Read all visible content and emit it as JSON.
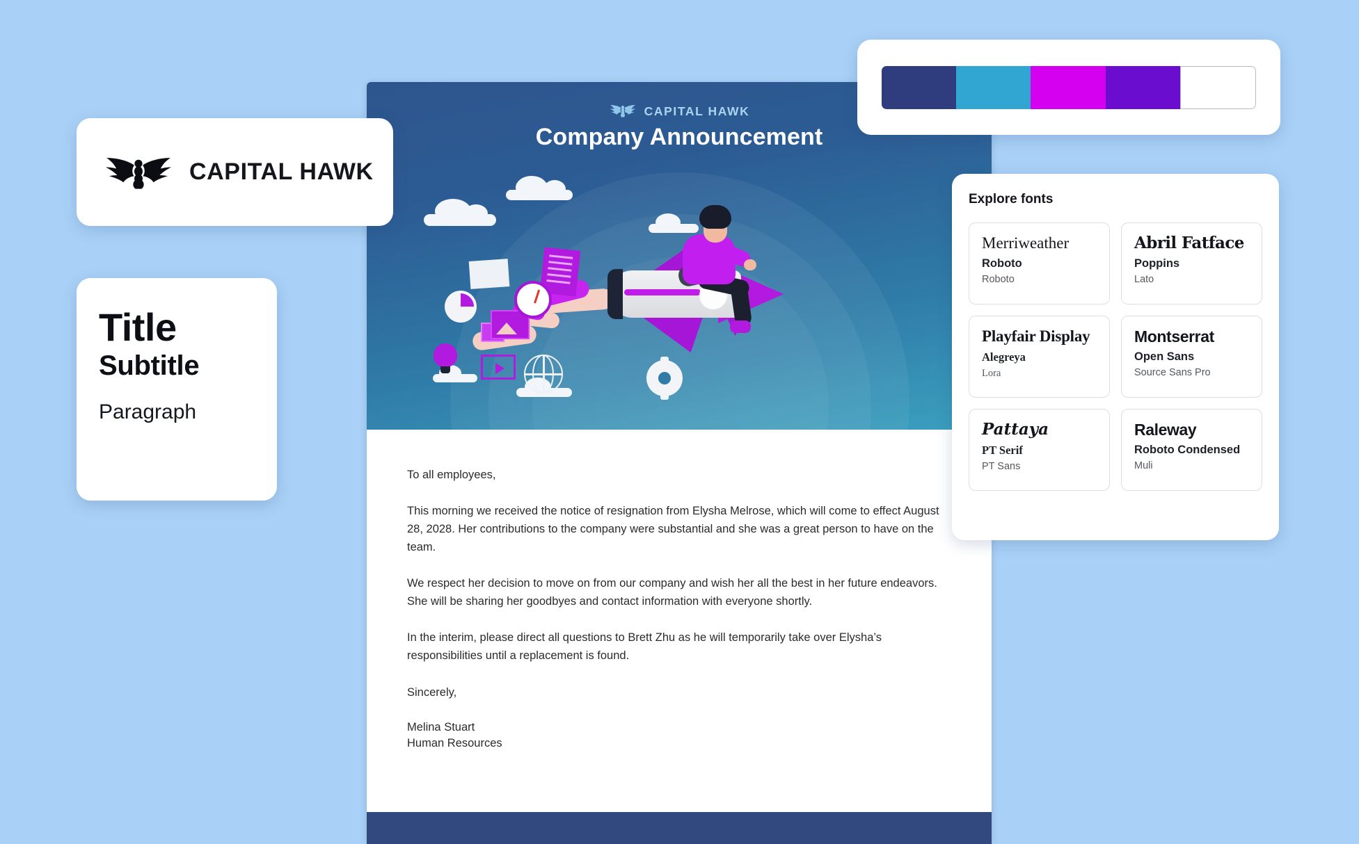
{
  "background_color": "#a9d1f7",
  "brand": {
    "logo_card_name": "CAPITAL HAWK",
    "logo_icon": "hawk-logo-icon",
    "header_logo_icon": "hawk-logo-icon",
    "header_brand_name": "CAPITAL HAWK"
  },
  "typography_card": {
    "title": "Title",
    "subtitle": "Subtitle",
    "paragraph": "Paragraph"
  },
  "palette": {
    "swatches": [
      {
        "name": "navy",
        "hex": "#2f3d7e"
      },
      {
        "name": "cyan-blue",
        "hex": "#31a6d3"
      },
      {
        "name": "magenta",
        "hex": "#d600f0"
      },
      {
        "name": "purple",
        "hex": "#6a0dcf"
      },
      {
        "name": "white",
        "hex": "#ffffff"
      }
    ]
  },
  "fonts_panel": {
    "title": "Explore fonts",
    "items": [
      {
        "heading": "Merriweather",
        "sub": "Roboto",
        "body": "Roboto"
      },
      {
        "heading": "Abril Fatface",
        "sub": "Poppins",
        "body": "Lato"
      },
      {
        "heading": "Playfair Display",
        "sub": "Alegreya",
        "body": "Lora"
      },
      {
        "heading": "Montserrat",
        "sub": "Open Sans",
        "body": "Source Sans Pro"
      },
      {
        "heading": "Pattaya",
        "sub": "PT Serif",
        "body": "PT Sans"
      },
      {
        "heading": "Raleway",
        "sub": "Roboto Condensed",
        "body": "Muli"
      }
    ]
  },
  "document": {
    "title": "Company Announcement",
    "illustration": "man-riding-rocket-illustration",
    "body": {
      "salutation": "To all employees,",
      "p1": "This morning we received the notice of resignation from Elysha Melrose, which will come to effect August 28, 2028. Her contributions to the company were substantial and she was a great person to have on the team.",
      "p2": "We respect her decision to move on from our company and wish her all the best in her future endeavors. She will be sharing her goodbyes and contact information with everyone shortly.",
      "p3": "In the interim, please direct all questions to Brett Zhu as he will temporarily take over Elysha’s responsibilities until a replacement is found.",
      "closing": "Sincerely,",
      "signer_name": "Melina Stuart",
      "signer_role": "Human Resources"
    },
    "footer_color": "#31497f"
  }
}
